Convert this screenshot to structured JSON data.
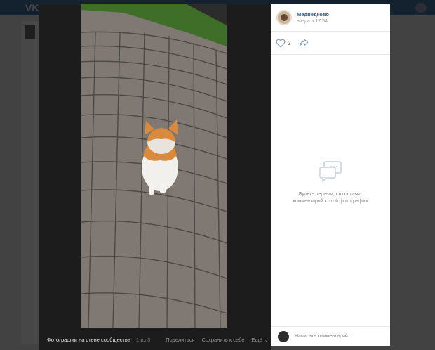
{
  "owner": {
    "name": "Медведково",
    "date": "вчера в 17:54"
  },
  "likes": {
    "count": "2"
  },
  "comments": {
    "empty_message": "Будьте первым, кто оставит комментарий к этой фотографии",
    "input_placeholder": "Написать комментарий..."
  },
  "footer": {
    "album": "Фотографии на стене сообщества",
    "counter": "1 из 3",
    "share": "Поделиться",
    "save": "Сохранить к себе",
    "more": "Ещё"
  },
  "colors": {
    "accent": "#2a5885",
    "header": "#4a76a8"
  }
}
